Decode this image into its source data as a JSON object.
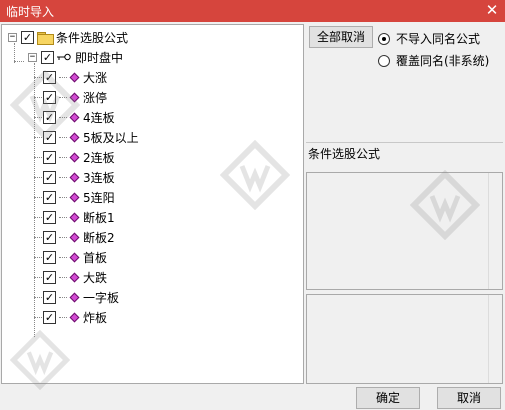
{
  "window": {
    "title": "临时导入",
    "close_glyph": "✕"
  },
  "tree": {
    "root": {
      "label": "条件选股公式",
      "checked": true,
      "expanded": true
    },
    "group": {
      "label": "即时盘中",
      "checked": true,
      "expanded": true
    },
    "items": [
      {
        "label": "大涨",
        "checked": true
      },
      {
        "label": "涨停",
        "checked": true
      },
      {
        "label": "4连板",
        "checked": true
      },
      {
        "label": "5板及以上",
        "checked": true
      },
      {
        "label": "2连板",
        "checked": true
      },
      {
        "label": "3连板",
        "checked": true
      },
      {
        "label": "5连阳",
        "checked": true
      },
      {
        "label": "断板1",
        "checked": true
      },
      {
        "label": "断板2",
        "checked": true
      },
      {
        "label": "首板",
        "checked": true
      },
      {
        "label": "大跌",
        "checked": true
      },
      {
        "label": "一字板",
        "checked": true
      },
      {
        "label": "炸板",
        "checked": true
      }
    ]
  },
  "options": {
    "cancel_all_label": "全部取消",
    "no_import_same_label": "不导入同名公式",
    "overwrite_same_label": "覆盖同名(非系统)",
    "selected": "no_import_same"
  },
  "detail": {
    "section_label": "条件选股公式"
  },
  "footer": {
    "ok_label": "确定",
    "cancel_label": "取消"
  },
  "colors": {
    "titlebar": "#d6453d",
    "diamond": "#d24bd2"
  }
}
